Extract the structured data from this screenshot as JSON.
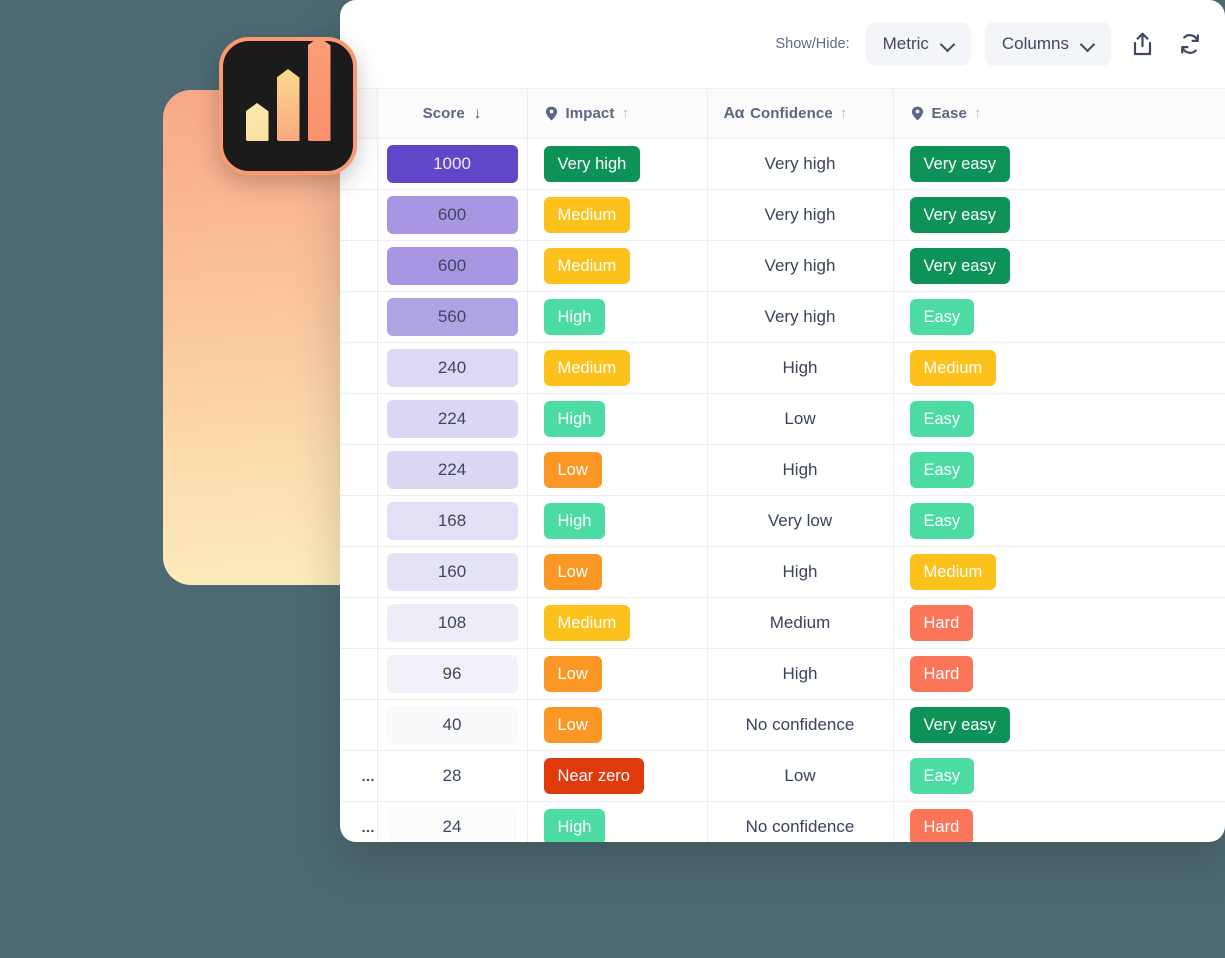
{
  "background_color": "#4d6a72",
  "brand": {
    "logo_name": "bar-chart-logo",
    "tile_color": "#1b1b1b",
    "border_color": "#fb9a72",
    "panel_gradient_from": "#f7a98a",
    "panel_gradient_to": "#fdeebd"
  },
  "toolbar": {
    "showhide_label": "Show/Hide:",
    "metric_label": "Metric",
    "columns_label": "Columns",
    "share_icon": "share-icon",
    "refresh_icon": "refresh-icon"
  },
  "table": {
    "columns": [
      {
        "key": "peek",
        "label": "",
        "icon": "",
        "sort": ""
      },
      {
        "key": "score",
        "label": "Score",
        "icon": "",
        "sort": "down"
      },
      {
        "key": "impact",
        "label": "Impact",
        "icon": "tag-icon",
        "sort": "up"
      },
      {
        "key": "confidence",
        "label": "Confidence",
        "icon": "aa-icon",
        "sort": "up"
      },
      {
        "key": "ease",
        "label": "Ease",
        "icon": "tag-icon",
        "sort": "up"
      }
    ],
    "sort_down_glyph": "↓",
    "sort_up_glyph": "↑",
    "aa_glyph": "Aα",
    "peek_text": "…",
    "rows": [
      {
        "score": "1000",
        "score_color": "#6246c8",
        "score_text": "#efeaff",
        "impact": "Very high",
        "impact_color": "#0d9358",
        "confidence": "Very high",
        "ease": "Very easy",
        "ease_color": "#0d9358",
        "peek": ""
      },
      {
        "score": "600",
        "score_color": "#a996e2",
        "score_text": "#3d4760",
        "impact": "Medium",
        "impact_color": "#fcc21b",
        "confidence": "Very high",
        "ease": "Very easy",
        "ease_color": "#0d9358",
        "peek": ""
      },
      {
        "score": "600",
        "score_color": "#a996e2",
        "score_text": "#3d4760",
        "impact": "Medium",
        "impact_color": "#fcc21b",
        "confidence": "Very high",
        "ease": "Very easy",
        "ease_color": "#0d9358",
        "peek": ""
      },
      {
        "score": "560",
        "score_color": "#b0a3e4",
        "score_text": "#3d4760",
        "impact": "High",
        "impact_color": "#4ddba4",
        "confidence": "Very high",
        "ease": "Easy",
        "ease_color": "#4ddba4",
        "peek": ""
      },
      {
        "score": "240",
        "score_color": "#ddd8f4",
        "score_text": "#3d4760",
        "impact": "Medium",
        "impact_color": "#fcc21b",
        "confidence": "High",
        "ease": "Medium",
        "ease_color": "#fcc21b",
        "peek": ""
      },
      {
        "score": "224",
        "score_color": "#dcd8f3",
        "score_text": "#3d4760",
        "impact": "High",
        "impact_color": "#4ddba4",
        "confidence": "Low",
        "ease": "Easy",
        "ease_color": "#4ddba4",
        "peek": ""
      },
      {
        "score": "224",
        "score_color": "#dcd8f3",
        "score_text": "#3d4760",
        "impact": "Low",
        "impact_color": "#fb9825",
        "confidence": "High",
        "ease": "Easy",
        "ease_color": "#4ddba4",
        "peek": ""
      },
      {
        "score": "168",
        "score_color": "#e3e0f5",
        "score_text": "#3d4760",
        "impact": "High",
        "impact_color": "#4ddba4",
        "confidence": "Very low",
        "ease": "Easy",
        "ease_color": "#4ddba4",
        "peek": ""
      },
      {
        "score": "160",
        "score_color": "#e5e3f6",
        "score_text": "#3d4760",
        "impact": "Low",
        "impact_color": "#fb9825",
        "confidence": "High",
        "ease": "Medium",
        "ease_color": "#fcc21b",
        "peek": ""
      },
      {
        "score": "108",
        "score_color": "#eeedf7",
        "score_text": "#3d4760",
        "impact": "Medium",
        "impact_color": "#fcc21b",
        "confidence": "Medium",
        "ease": "Hard",
        "ease_color": "#fb7559",
        "peek": ""
      },
      {
        "score": "96",
        "score_color": "#f2f1f9",
        "score_text": "#3d4760",
        "impact": "Low",
        "impact_color": "#fb9825",
        "confidence": "High",
        "ease": "Hard",
        "ease_color": "#fb7559",
        "peek": ""
      },
      {
        "score": "40",
        "score_color": "#fafafc",
        "score_text": "#3d4760",
        "impact": "Low",
        "impact_color": "#fb9825",
        "confidence": "No confidence",
        "ease": "Very easy",
        "ease_color": "#0d9358",
        "peek": ""
      },
      {
        "score": "28",
        "score_color": "#ffffff",
        "score_text": "#3d4760",
        "impact": "Near zero",
        "impact_color": "#e03a0c",
        "confidence": "Low",
        "ease": "Easy",
        "ease_color": "#4ddba4",
        "peek": "…"
      },
      {
        "score": "24",
        "score_color": "#fcfcfd",
        "score_text": "#3d4760",
        "impact": "High",
        "impact_color": "#4ddba4",
        "confidence": "No confidence",
        "ease": "Hard",
        "ease_color": "#fb7559",
        "peek": "…"
      }
    ]
  }
}
